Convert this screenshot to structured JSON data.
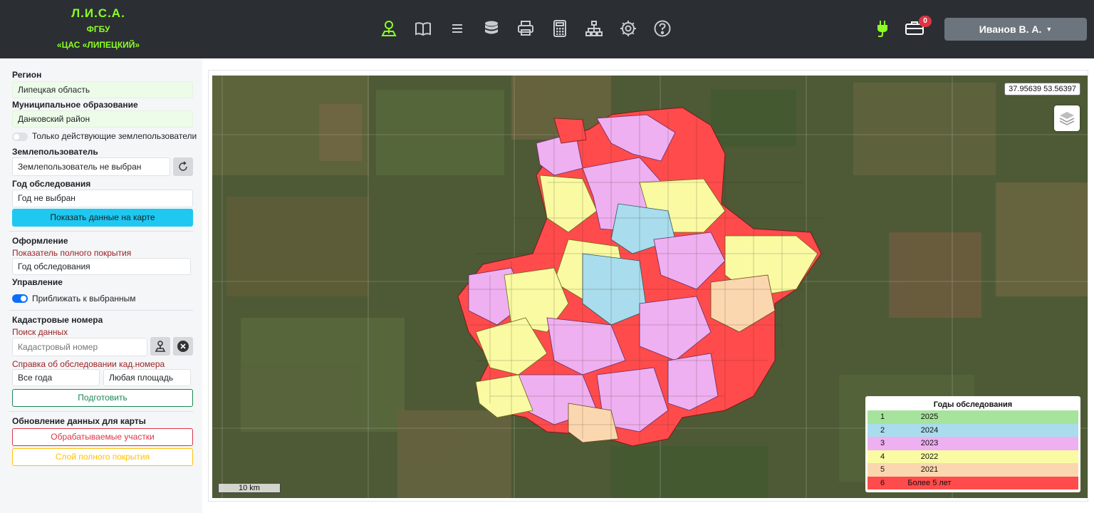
{
  "header": {
    "brand_title": "Л.И.С.А.",
    "brand_line2": "ФГБУ",
    "brand_line3": "«ЦАС «ЛИПЕЦКИЙ»",
    "nav_icons": [
      "map-marker-icon",
      "book-icon",
      "menu-icon",
      "database-icon",
      "printer-icon",
      "calculator-icon",
      "sitemap-icon",
      "gear-icon",
      "help-icon"
    ],
    "notifications_count": "0",
    "user_name": "Иванов В. А.",
    "accent_color": "#8cff22"
  },
  "sidebar": {
    "region_label": "Регион",
    "region_value": "Липецкая область",
    "municipality_label": "Муниципальное образование",
    "municipality_value": "Данковский район",
    "only_active_label": "Только действующие землепользователи",
    "only_active_on": false,
    "landuser_label": "Землепользователь",
    "landuser_value": "Землепользователь не выбран",
    "year_label": "Год обследования",
    "year_value": "Год не выбран",
    "show_button": "Показать данные на карте",
    "design_label": "Оформление",
    "indicator_label": "Показатель полного покрытия",
    "indicator_value": "Год обследования",
    "control_label": "Управление",
    "zoom_selected_label": "Приближать к выбранным",
    "zoom_selected_on": true,
    "cadastral_label": "Кадастровые номера",
    "search_label": "Поиск данных",
    "cadastral_placeholder": "Кадастровый номер",
    "reference_label": "Справка об обследовании кад.номера",
    "years_select": "Все года",
    "area_select": "Любая площадь",
    "prepare_button": "Подготовить",
    "update_label": "Обновление данных для карты",
    "processed_button": "Обрабатываемые участки",
    "coverage_button": "Слой полного покрытия"
  },
  "map": {
    "coordinates": "37.95639 53.56397",
    "scale_label": "10 km",
    "legend": {
      "title": "Годы обследования",
      "rows": [
        {
          "n": "1",
          "label": "2025",
          "color": "#a6e39c"
        },
        {
          "n": "2",
          "label": "2024",
          "color": "#a9dcec"
        },
        {
          "n": "3",
          "label": "2023",
          "color": "#eeb0f0"
        },
        {
          "n": "4",
          "label": "2022",
          "color": "#fafaa3"
        },
        {
          "n": "5",
          "label": "2021",
          "color": "#fbd7b0"
        },
        {
          "n": "6",
          "label": "Более 5 лет",
          "color": "#ff4b4b"
        }
      ]
    }
  }
}
